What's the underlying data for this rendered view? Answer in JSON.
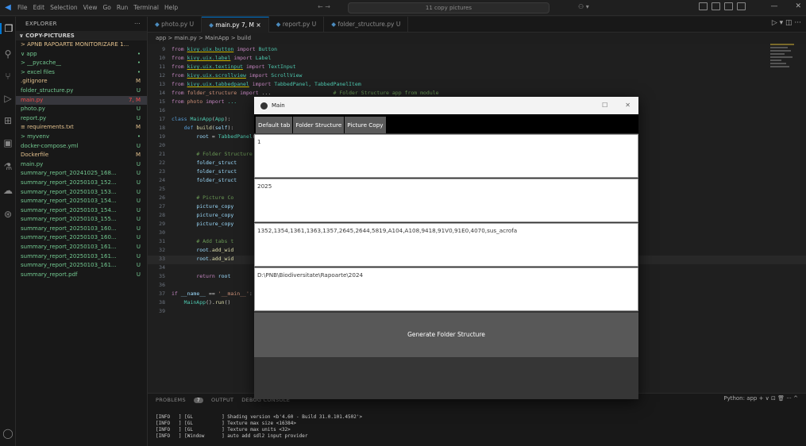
{
  "titlebar": {
    "menu": [
      "File",
      "Edit",
      "Selection",
      "View",
      "Go",
      "Run",
      "Terminal",
      "Help"
    ],
    "search": "11 copy pictures"
  },
  "sidebar": {
    "header": "EXPLORER",
    "folder": "COPY-PICTURES",
    "items": [
      {
        "label": "> APNB RAPOARTE MONITORIZARE 1...",
        "status": "",
        "color": "c-orange"
      },
      {
        "label": "∨ app",
        "status": "•",
        "color": "c-green"
      },
      {
        "label": "  > __pycache__",
        "status": "•",
        "color": "c-green"
      },
      {
        "label": "  > excel files",
        "status": "•",
        "color": "c-green"
      },
      {
        "label": "  .gitignore",
        "status": "M",
        "color": "c-orange"
      },
      {
        "label": "  folder_structure.py",
        "status": "U",
        "color": "c-green"
      },
      {
        "label": "  main.py",
        "status": "7, M",
        "color": "c-red"
      },
      {
        "label": "  photo.py",
        "status": "U",
        "color": "c-green"
      },
      {
        "label": "  report.py",
        "status": "U",
        "color": "c-green"
      },
      {
        "label": "  ≡ requirements.txt",
        "status": "M",
        "color": "c-orange"
      },
      {
        "label": "> myvenv",
        "status": "•",
        "color": "c-green"
      },
      {
        "label": "docker-compose.yml",
        "status": "U",
        "color": "c-green"
      },
      {
        "label": "Dockerfile",
        "status": "M",
        "color": "c-orange"
      },
      {
        "label": "main.py",
        "status": "U",
        "color": "c-green"
      },
      {
        "label": "summary_report_20241025_168...",
        "status": "U",
        "color": "c-green"
      },
      {
        "label": "summary_report_20250103_152...",
        "status": "U",
        "color": "c-green"
      },
      {
        "label": "summary_report_20250103_153...",
        "status": "U",
        "color": "c-green"
      },
      {
        "label": "summary_report_20250103_154...",
        "status": "U",
        "color": "c-green"
      },
      {
        "label": "summary_report_20250103_154...",
        "status": "U",
        "color": "c-green"
      },
      {
        "label": "summary_report_20250103_155...",
        "status": "U",
        "color": "c-green"
      },
      {
        "label": "summary_report_20250103_160...",
        "status": "U",
        "color": "c-green"
      },
      {
        "label": "summary_report_20250103_160...",
        "status": "U",
        "color": "c-green"
      },
      {
        "label": "summary_report_20250103_161...",
        "status": "U",
        "color": "c-green"
      },
      {
        "label": "summary_report_20250103_161...",
        "status": "U",
        "color": "c-green"
      },
      {
        "label": "summary_report_20250103_161...",
        "status": "U",
        "color": "c-green"
      },
      {
        "label": "summary_report.pdf",
        "status": "U",
        "color": "c-green"
      }
    ]
  },
  "tabs": [
    {
      "label": "photo.py U",
      "active": false
    },
    {
      "label": "main.py 7, M  ×",
      "active": true
    },
    {
      "label": "report.py U",
      "active": false
    },
    {
      "label": "folder_structure.py U",
      "active": false
    }
  ],
  "breadcrumb": "app > main.py > MainApp > build",
  "code": {
    "lines": [
      "9",
      "10",
      "11",
      "12",
      "13",
      "14",
      "15",
      "16",
      "17",
      "18",
      "19",
      "20",
      "21",
      "22",
      "23",
      "24",
      "25",
      "26",
      "27",
      "28",
      "29",
      "30",
      "31",
      "32",
      "33",
      "34",
      "35",
      "36",
      "37",
      "38",
      "39"
    ]
  },
  "panel": {
    "tabs": [
      "PROBLEMS",
      "7",
      "OUTPUT",
      "DEBUG CONSOLE"
    ],
    "right": "Python: app  +  ∨  ⊡  🗑  ···  ^",
    "terminal": [
      "[INFO   ] [GL          ] Shading version <b'4.60 - Build 31.0.101.4502'>",
      "[INFO   ] [GL          ] Texture max size <16384>",
      "[INFO   ] [GL          ] Texture max units <32>",
      "[INFO   ] [Window      ] auto add sdl2 input provider"
    ]
  },
  "kivy": {
    "title": "Main",
    "tabs": [
      "Default tab",
      "Folder Structure",
      "Picture Copy"
    ],
    "inputs": [
      "1",
      "2025",
      "1352,1354,1361,1363,1357,2645,2644,5819,A104,A108,9418,91V0,91E0,4070,sus_acrofa",
      "D:\\PNB\\Biodiversitate\\Rapoarte\\2024"
    ],
    "button": "Generate Folder Structure"
  }
}
